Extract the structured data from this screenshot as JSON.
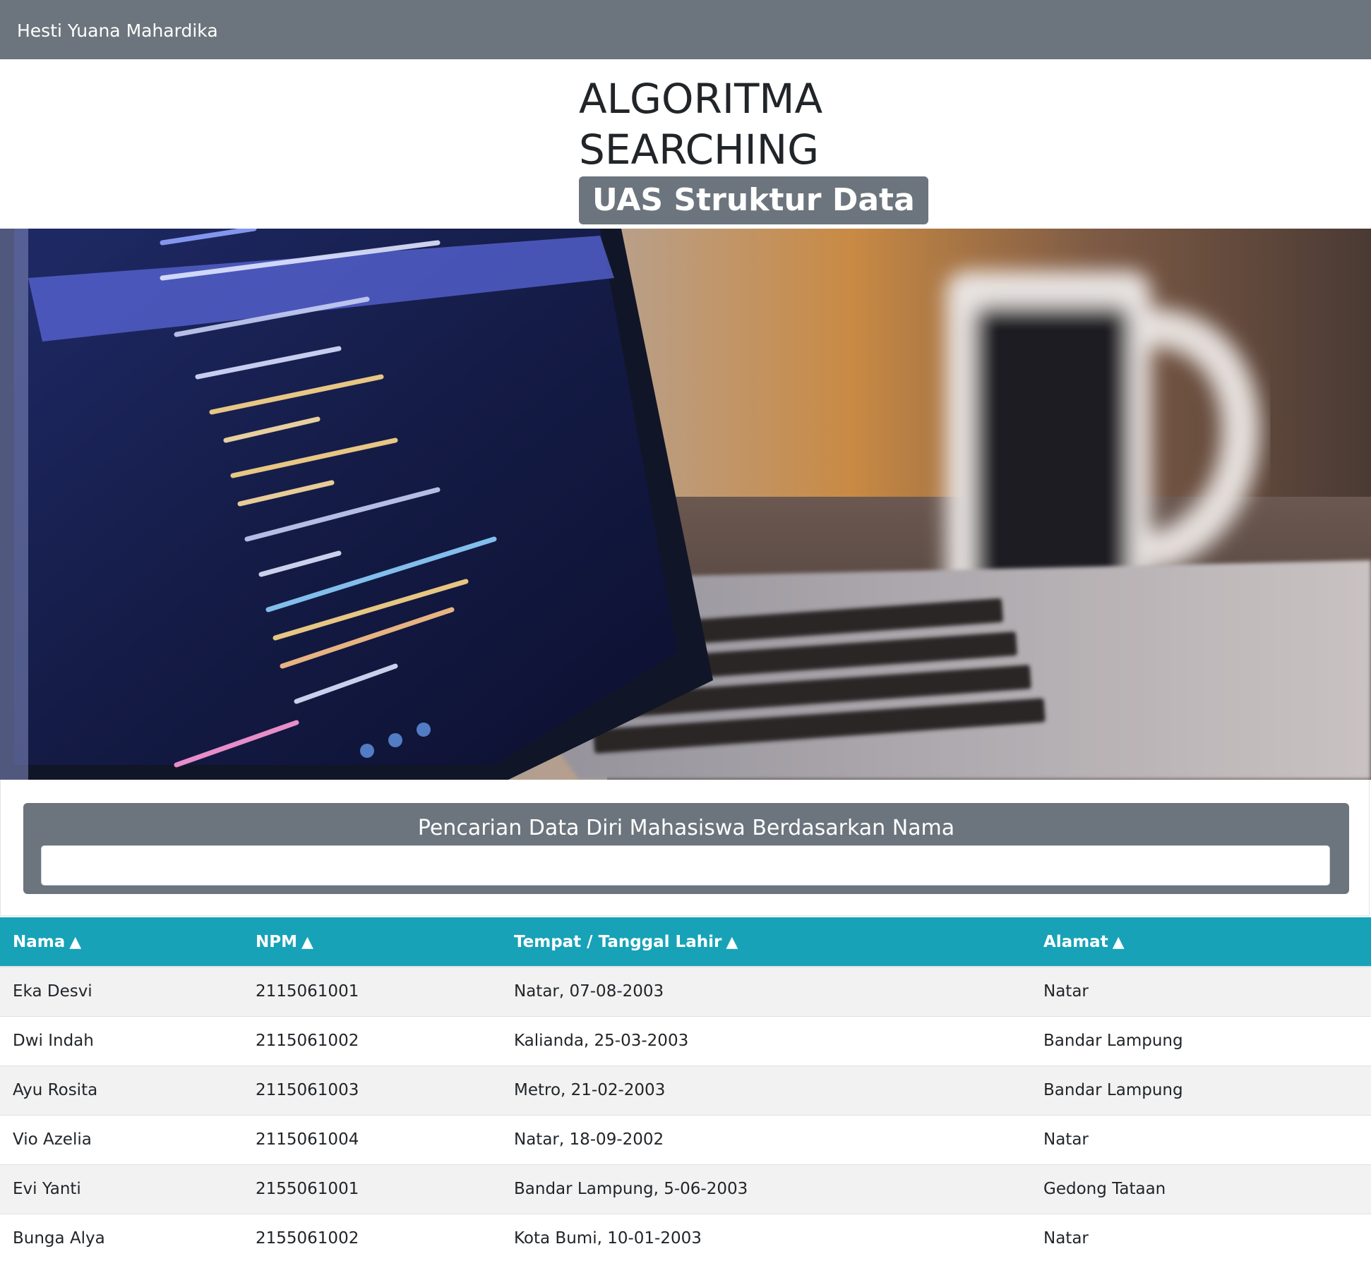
{
  "navbar": {
    "brand": "Hesti Yuana Mahardika",
    "background": "#6c757d"
  },
  "header": {
    "title_line1": "ALGORITMA",
    "title_line2": "SEARCHING",
    "subtitle": "UAS Struktur Data"
  },
  "hero": {
    "image": "laptop-code-coffee-photo"
  },
  "search": {
    "label": "Pencarian Data Diri Mahasiswa Berdasarkan Nama",
    "value": "",
    "placeholder": ""
  },
  "table": {
    "header_color": "#17a2b8",
    "columns": [
      {
        "label": "Nama",
        "icon": "sort-up-icon"
      },
      {
        "label": "NPM",
        "icon": "sort-up-icon"
      },
      {
        "label": "Tempat / Tanggal Lahir",
        "icon": "sort-up-icon"
      },
      {
        "label": "Alamat",
        "icon": "sort-up-icon"
      }
    ],
    "sort_glyph": "▲",
    "rows": [
      [
        "Eka Desvi",
        "2115061001",
        "Natar, 07-08-2003",
        "Natar"
      ],
      [
        "Dwi Indah",
        "2115061002",
        "Kalianda, 25-03-2003",
        "Bandar Lampung"
      ],
      [
        "Ayu Rosita",
        "2115061003",
        "Metro, 21-02-2003",
        "Bandar Lampung"
      ],
      [
        "Vio Azelia",
        "2115061004",
        "Natar, 18-09-2002",
        "Natar"
      ],
      [
        "Evi Yanti",
        "2155061001",
        "Bandar Lampung, 5-06-2003",
        "Gedong Tataan"
      ],
      [
        "Bunga Alya",
        "2155061002",
        "Kota Bumi, 10-01-2003",
        "Natar"
      ]
    ]
  }
}
